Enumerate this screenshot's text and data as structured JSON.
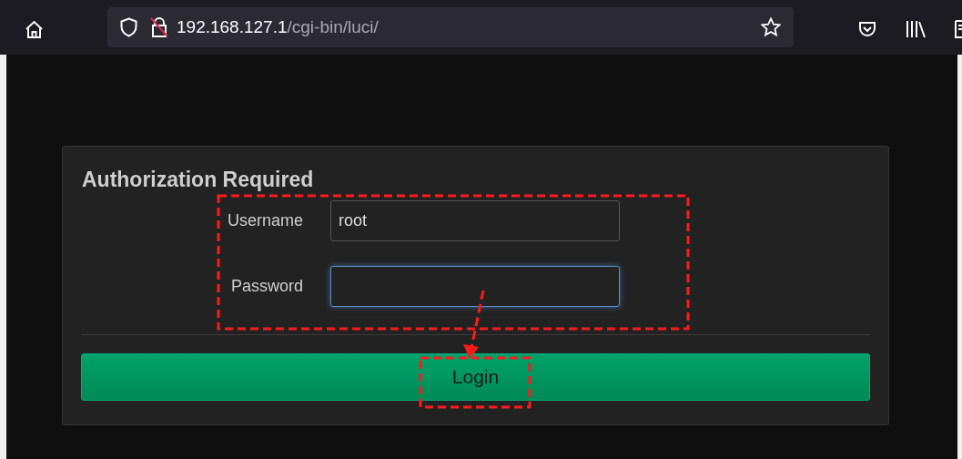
{
  "browser": {
    "url_host": "192.168.127.1",
    "url_path": "/cgi-bin/luci/"
  },
  "login": {
    "title": "Authorization Required",
    "fields": [
      {
        "label": "Username",
        "value": "root",
        "focused": false
      },
      {
        "label": "Password",
        "focused": true
      }
    ],
    "button": "Login"
  }
}
